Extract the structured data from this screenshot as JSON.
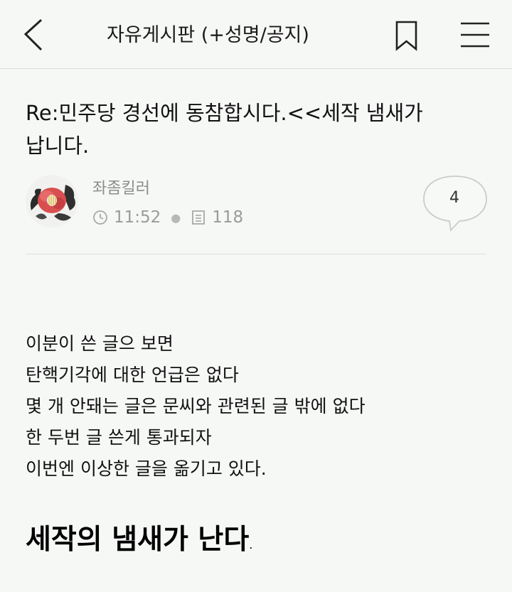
{
  "header": {
    "title": "자유게시판 (+성명/공지)",
    "icons": {
      "back": "chevron-left-icon",
      "bookmark": "bookmark-icon",
      "menu": "hamburger-menu-icon"
    }
  },
  "post": {
    "title": "Re:민주당 경선에 동참합시다.<<세작 냄새가 납니다.",
    "author": "좌좀킬러",
    "time": "11:52",
    "views": "118",
    "comment_count": "4",
    "icons": {
      "time": "clock-icon",
      "views": "document-icon",
      "comments": "speech-bubble-icon"
    }
  },
  "body": {
    "lines": [
      "이분이 쓴 글으 보면",
      "탄핵기각에 대한 언급은 없다",
      "몇 개 안돼는 글은 문씨와 관련된 글 밖에 없다",
      "한 두번 글 쓴게 통과되자",
      "이번엔 이상한 글을 옮기고 있다."
    ],
    "emphasis": "세작의 냄새가 난다",
    "emphasis_tail": "."
  },
  "colors": {
    "background": "#f6f8f6",
    "text": "#111111",
    "muted": "#9a9a9a",
    "divider": "#dcdfdc"
  }
}
